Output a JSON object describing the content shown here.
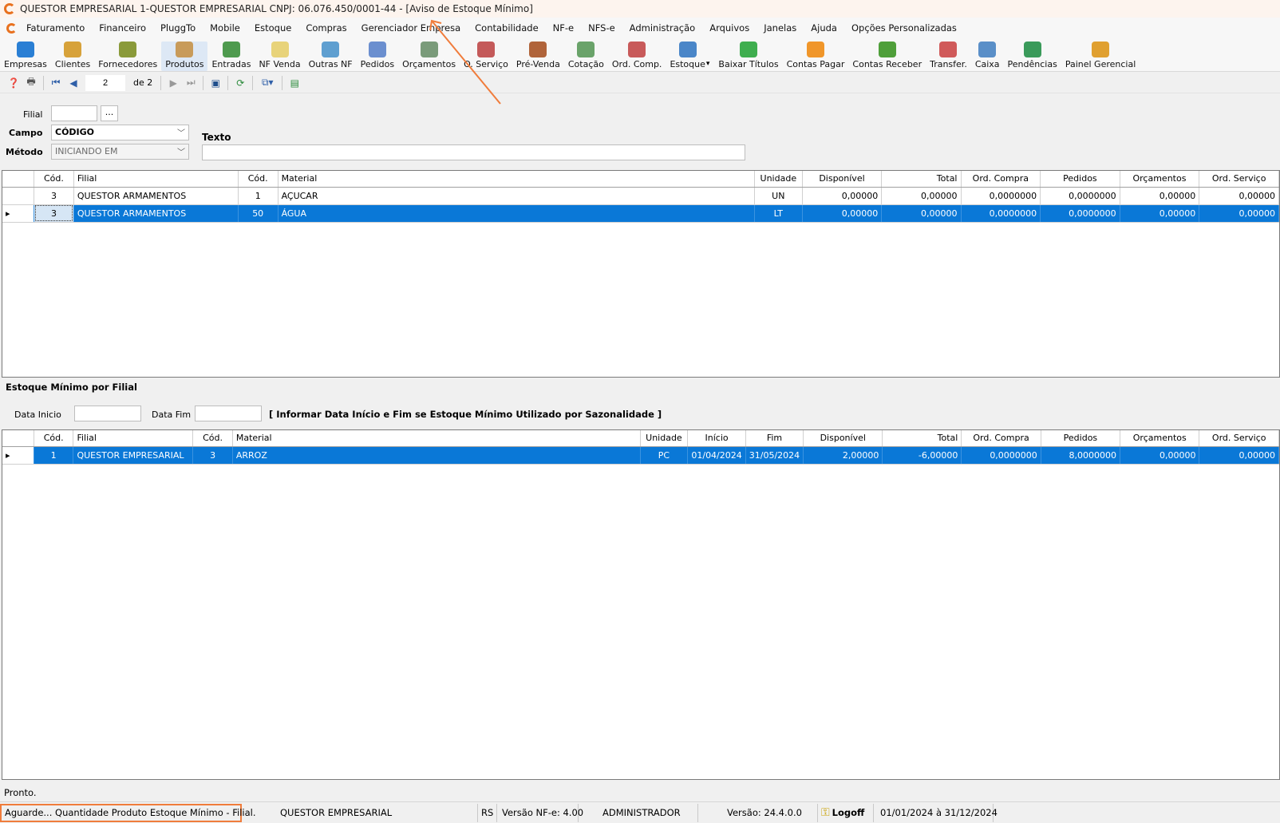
{
  "window": {
    "title": "QUESTOR EMPRESARIAL 1-QUESTOR EMPRESARIAL CNPJ: 06.076.450/0001-44 - [Aviso de Estoque Mínimo]"
  },
  "menu": [
    "Faturamento",
    "Financeiro",
    "PluggTo",
    "Mobile",
    "Estoque",
    "Compras",
    "Gerenciador Empresa",
    "Contabilidade",
    "NF-e",
    "NFS-e",
    "Administração",
    "Arquivos",
    "Janelas",
    "Ajuda",
    "Opções Personalizadas"
  ],
  "toolbar": [
    {
      "label": "Empresas",
      "icon": "empresas-icon",
      "color": "#2a7fd4"
    },
    {
      "label": "Clientes",
      "icon": "clientes-icon",
      "color": "#d7a23a"
    },
    {
      "label": "Fornecedores",
      "icon": "fornecedores-icon",
      "color": "#8a9a3a"
    },
    {
      "label": "Produtos",
      "icon": "produtos-icon",
      "color": "#c89b5a"
    },
    {
      "label": "Entradas",
      "icon": "entradas-icon",
      "color": "#4e9a4e"
    },
    {
      "label": "NF Venda",
      "icon": "nf-venda-icon",
      "color": "#e8d37a"
    },
    {
      "label": "Outras NF",
      "icon": "outras-nf-icon",
      "color": "#5f9fd0"
    },
    {
      "label": "Pedidos",
      "icon": "pedidos-icon",
      "color": "#6b8fcf"
    },
    {
      "label": "Orçamentos",
      "icon": "orcamentos-icon",
      "color": "#7a9b7a"
    },
    {
      "label": "O. Serviço",
      "icon": "ordem-servico-icon",
      "color": "#c45a5a"
    },
    {
      "label": "Pré-Venda",
      "icon": "pre-venda-icon",
      "color": "#b0643a"
    },
    {
      "label": "Cotação",
      "icon": "cotacao-icon",
      "color": "#6aa36a"
    },
    {
      "label": "Ord. Comp.",
      "icon": "ordem-compra-icon",
      "color": "#c85a5a"
    },
    {
      "label": "Estoque",
      "icon": "estoque-icon",
      "color": "#4a86c8"
    },
    {
      "label": "Baixar Títulos",
      "icon": "baixar-titulos-icon",
      "color": "#3fae4f"
    },
    {
      "label": "Contas Pagar",
      "icon": "contas-pagar-icon",
      "color": "#f0962a"
    },
    {
      "label": "Contas Receber",
      "icon": "contas-receber-icon",
      "color": "#4f9f3a"
    },
    {
      "label": "Transfer.",
      "icon": "transfer-icon",
      "color": "#d05a5a"
    },
    {
      "label": "Caixa",
      "icon": "caixa-icon",
      "color": "#5a8fc8"
    },
    {
      "label": "Pendências",
      "icon": "pendencias-icon",
      "color": "#3a9a5a"
    },
    {
      "label": "Painel Gerencial",
      "icon": "painel-gerencial-icon",
      "color": "#e0a030"
    }
  ],
  "nav": {
    "page": "2",
    "of_label": "de 2"
  },
  "filter": {
    "filial_label": "Filial",
    "filial_btn": "...",
    "campo_label": "Campo",
    "campo_value": "CÓDIGO",
    "metodo_label": "Método",
    "metodo_value": "INICIANDO EM",
    "texto_label": "Texto"
  },
  "grid1": {
    "headers": [
      "",
      "Cód.",
      "Filial",
      "Cód.",
      "Material",
      "Unidade",
      "Disponível",
      "Total",
      "Ord. Compra",
      "Pedidos",
      "Orçamentos",
      "Ord. Serviço"
    ],
    "rows": [
      [
        "",
        "3",
        "QUESTOR ARMAMENTOS",
        "1",
        "AÇUCAR",
        "UN",
        "0,00000",
        "0,00000",
        "0,0000000",
        "0,0000000",
        "0,00000",
        "0,00000"
      ],
      [
        "▸",
        "3",
        "QUESTOR ARMAMENTOS",
        "50",
        "ÁGUA",
        "LT",
        "0,00000",
        "0,00000",
        "0,0000000",
        "0,0000000",
        "0,00000",
        "0,00000"
      ]
    ]
  },
  "section2": {
    "title": "Estoque Mínimo por Filial",
    "data_inicio_label": "Data Inicio",
    "data_fim_label": "Data Fim",
    "hint": "[ Informar Data Início e Fim se Estoque Mínimo Utilizado por Sazonalidade ]"
  },
  "grid2": {
    "headers": [
      "",
      "Cód.",
      "Filial",
      "Cód.",
      "Material",
      "Unidade",
      "Início",
      "Fim",
      "Disponível",
      "Total",
      "Ord. Compra",
      "Pedidos",
      "Orçamentos",
      "Ord. Serviço"
    ],
    "rows": [
      [
        "▸",
        "1",
        "QUESTOR EMPRESARIAL",
        "3",
        "ARROZ",
        "PC",
        "01/04/2024",
        "31/05/2024",
        "2,00000",
        "-6,00000",
        "0,0000000",
        "8,0000000",
        "0,00000",
        "0,00000"
      ]
    ]
  },
  "status": {
    "line": "Pronto.",
    "message": "Aguarde... Quantidade Produto Estoque Mínimo - Filial.",
    "company": "QUESTOR EMPRESARIAL",
    "state": "RS",
    "nfe_version": "Versão NF-e: 4.00",
    "user": "ADMINISTRADOR",
    "version": "Versão: 24.4.0.0",
    "logoff": "Logoff",
    "period": "01/01/2024 à 31/12/2024"
  },
  "colors": {
    "accent": "#e8711f",
    "selection": "#0a78d7",
    "highlight_box": "#f07c3b"
  }
}
